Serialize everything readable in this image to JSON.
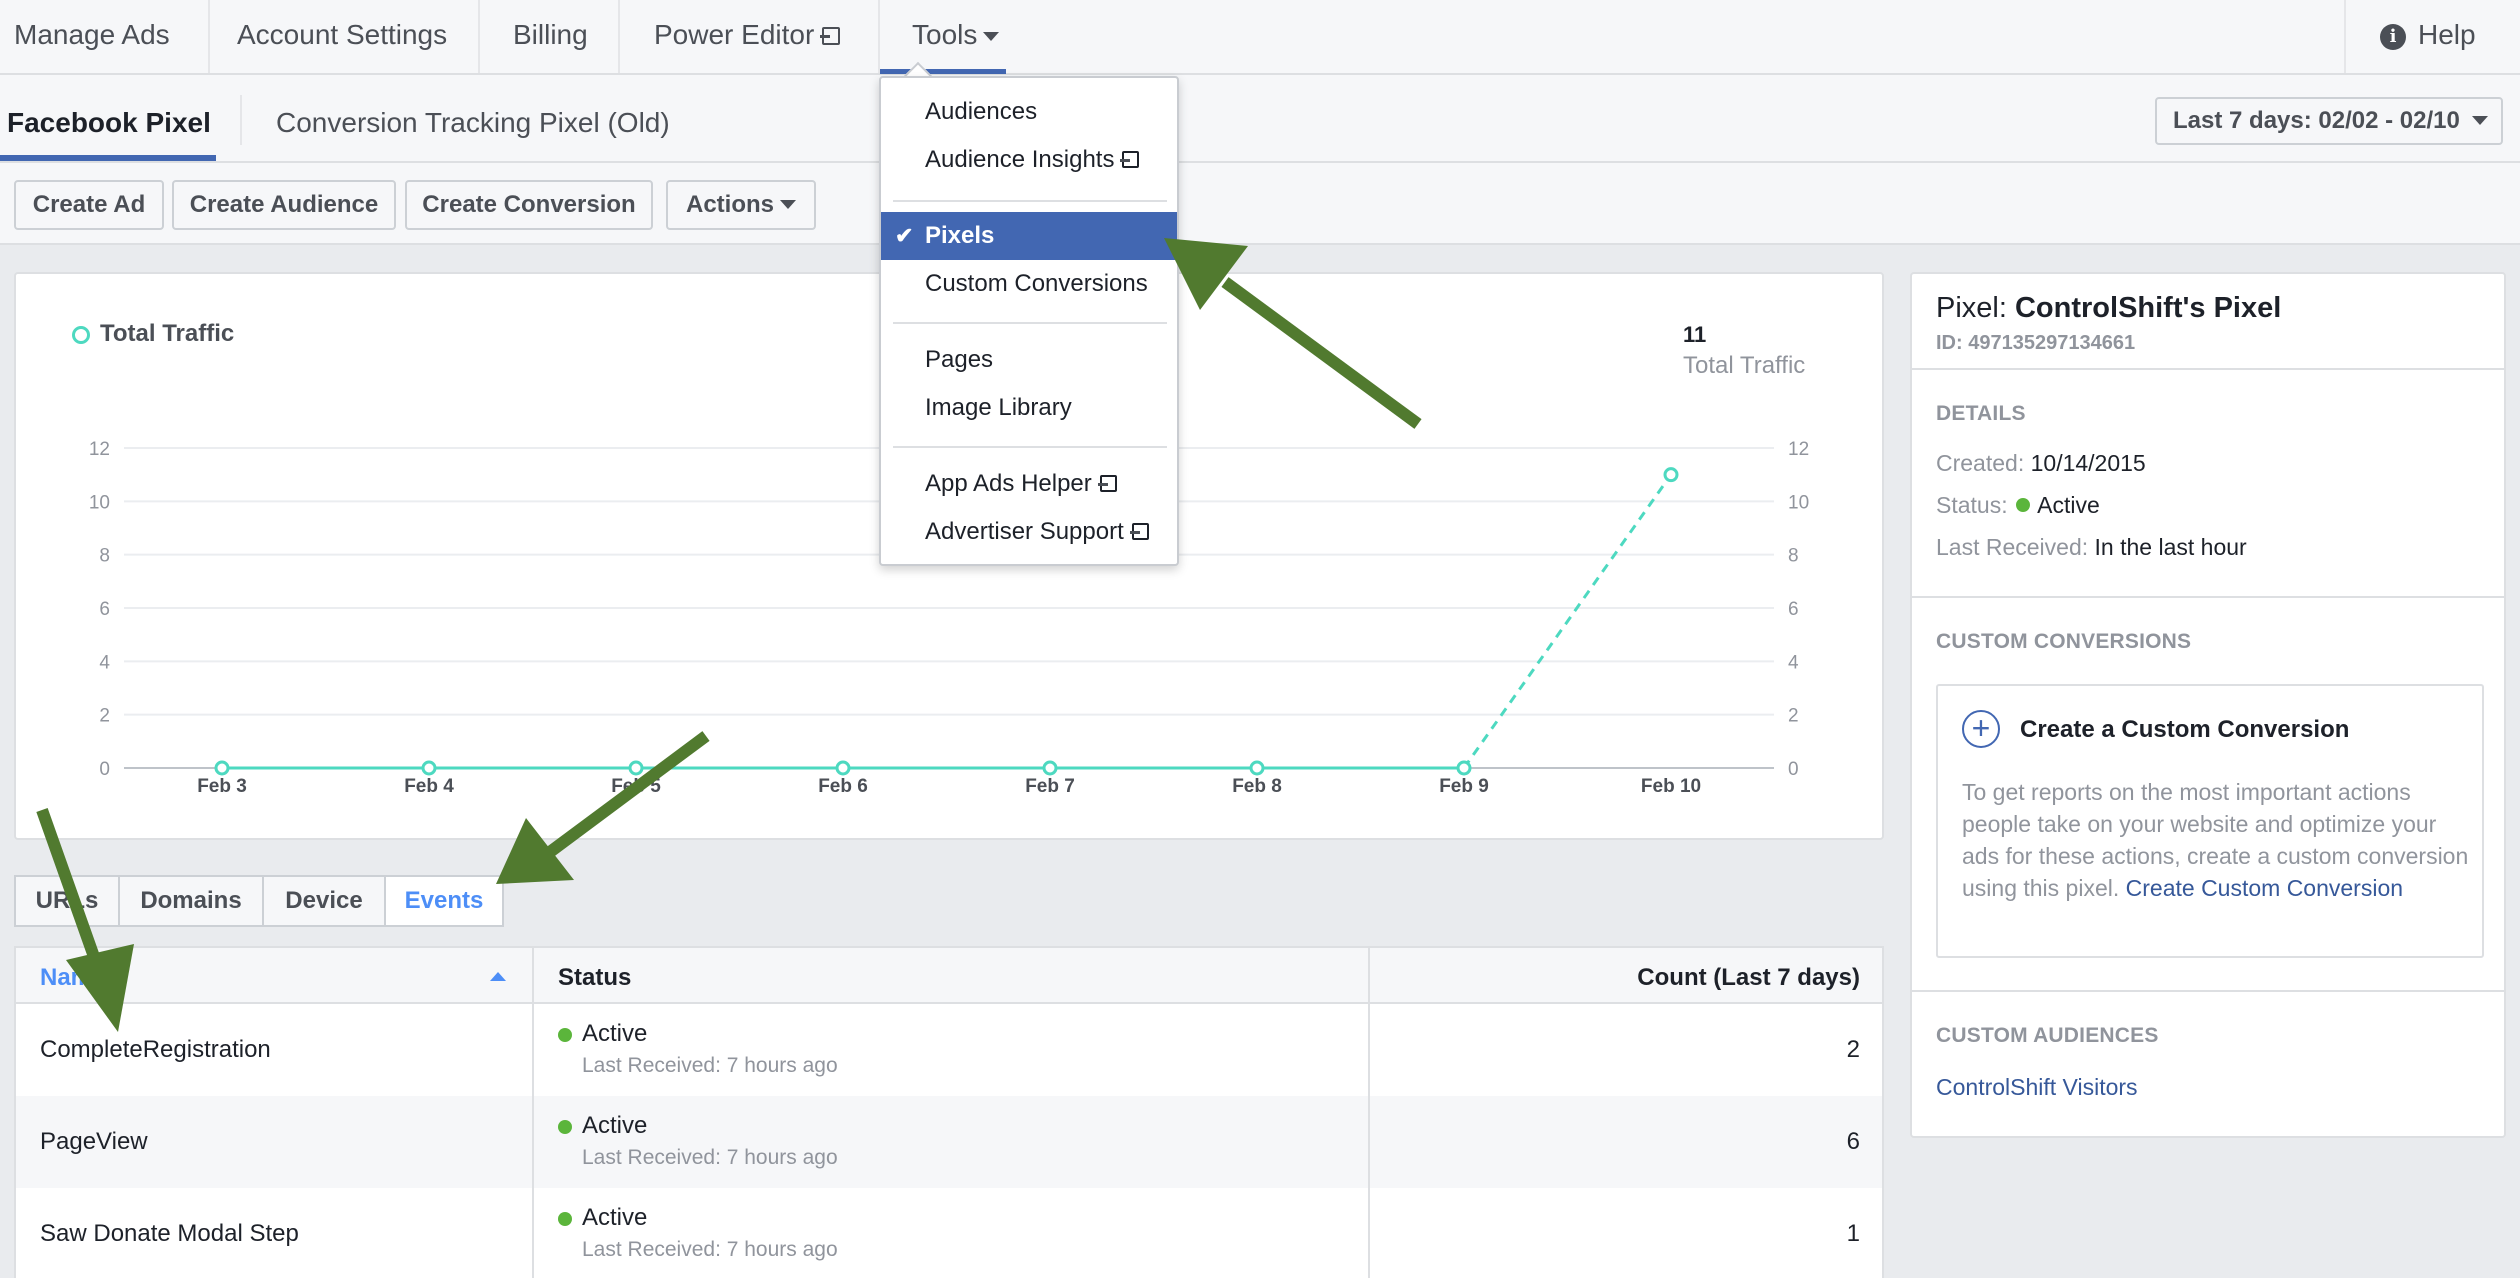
{
  "topnav": {
    "items": [
      "Manage Ads",
      "Account Settings",
      "Billing",
      "Power Editor",
      "Tools"
    ],
    "help": "Help"
  },
  "subnav": {
    "tabs": [
      "Facebook Pixel",
      "Conversion Tracking Pixel (Old)"
    ],
    "date_range": "Last 7 days: 02/02 - 02/10"
  },
  "toolbar": {
    "buttons": [
      "Create Ad",
      "Create Audience",
      "Create Conversion",
      "Actions"
    ]
  },
  "tools_menu": {
    "items": [
      "Audiences",
      "Audience Insights",
      "Pixels",
      "Custom Conversions",
      "Pages",
      "Image Library",
      "App Ads Helper",
      "Advertiser Support"
    ],
    "selected": "Pixels",
    "check_glyph": "✔"
  },
  "chart_data": {
    "type": "line",
    "title": "",
    "legend": [
      "Total Traffic"
    ],
    "summary": {
      "value": "11",
      "label": "Total Traffic"
    },
    "categories": [
      "Feb 3",
      "Feb 4",
      "Feb 5",
      "Feb 6",
      "Feb 7",
      "Feb 8",
      "Feb 9",
      "Feb 10"
    ],
    "series": [
      {
        "name": "Total Traffic",
        "values": [
          0,
          0,
          0,
          0,
          0,
          0,
          0,
          11
        ]
      }
    ],
    "yticks": [
      "0",
      "2",
      "4",
      "6",
      "8",
      "10",
      "12"
    ],
    "ylim": [
      0,
      12
    ],
    "grid": true,
    "color": "#4dd9c0",
    "last_segment_dashed": true
  },
  "bottom_tabs": {
    "items": [
      "URLs",
      "Domains",
      "Device",
      "Events"
    ],
    "active": "Events"
  },
  "events_table": {
    "headers": [
      "Name",
      "Status",
      "Count (Last 7 days)"
    ],
    "rows": [
      {
        "name": "CompleteRegistration",
        "status": "Active",
        "received": "Last Received: 7 hours ago",
        "count": "2"
      },
      {
        "name": "PageView",
        "status": "Active",
        "received": "Last Received: 7 hours ago",
        "count": "6"
      },
      {
        "name": "Saw Donate Modal Step",
        "status": "Active",
        "received": "Last Received: 7 hours ago",
        "count": "1"
      }
    ]
  },
  "pixel_panel": {
    "title_prefix": "Pixel:",
    "title_name": "ControlShift's Pixel",
    "id": "ID: 497135297134661",
    "details_heading": "DETAILS",
    "created_label": "Created:",
    "created_value": "10/14/2015",
    "status_label": "Status:",
    "status_value": "Active",
    "last_received_label": "Last Received:",
    "last_received_value": "In the last hour",
    "custom_conversions_heading": "CUSTOM CONVERSIONS",
    "cc_title": "Create a Custom Conversion",
    "cc_body": "To get reports on the most important actions people take on your website and optimize your ads for these actions, create a custom conversion using this pixel.",
    "cc_link": "Create Custom Conversion",
    "custom_audiences_heading": "CUSTOM AUDIENCES",
    "audience_link": "ControlShift Visitors"
  },
  "colors": {
    "accent": "#4267b2",
    "link": "#365899",
    "active_tab": "#4d8ef7",
    "status_dot": "#5bb53b",
    "annotation_arrow": "#517a2f"
  }
}
